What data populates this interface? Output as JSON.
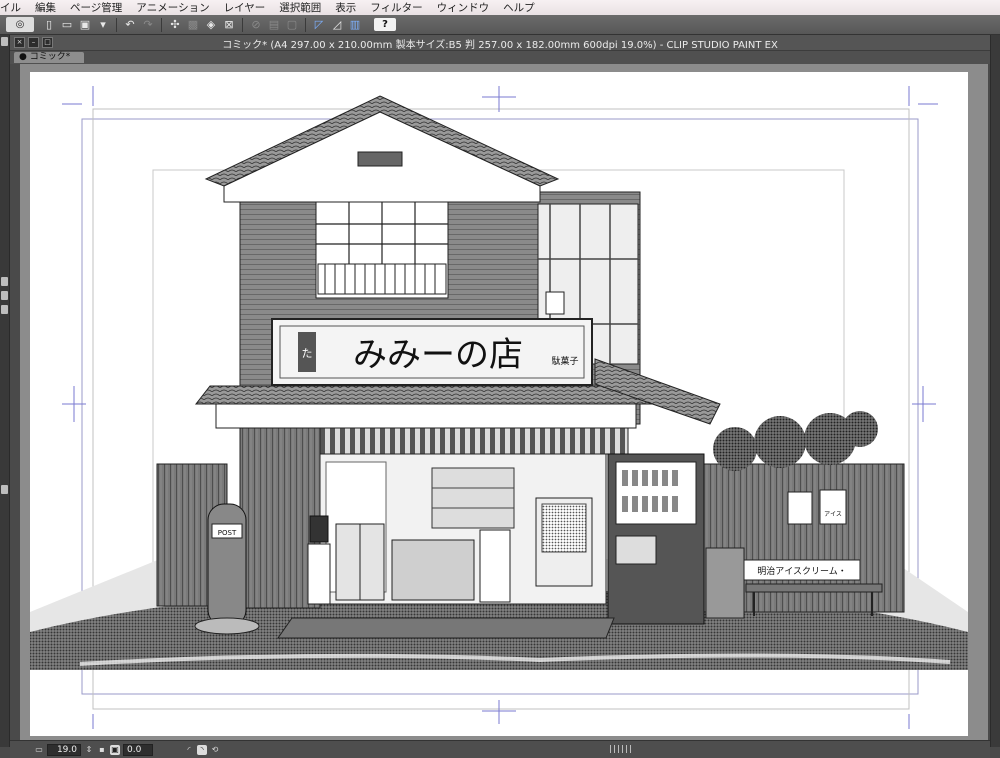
{
  "menu": [
    "イル",
    "編集",
    "ページ管理",
    "アニメーション",
    "レイヤー",
    "選択範囲",
    "表示",
    "フィルター",
    "ウィンドウ",
    "ヘルプ"
  ],
  "window": {
    "title": "コミック* (A4 297.00 x 210.00mm 製本サイズ:B5 判 257.00 x 182.00mm 600dpi 19.0%)  - CLIP STUDIO PAINT EX"
  },
  "tab": {
    "label": "コミック*"
  },
  "toolbar": {
    "help_label": "?"
  },
  "artwork": {
    "shop_sign": "みみーの店",
    "sign_tag": "た",
    "sign_sub": "駄菓子",
    "post_label": "POST",
    "bench_sign": "明治アイスクリーム・",
    "poster_text": "アイス"
  },
  "statusbar": {
    "zoom": "19.0",
    "rotation": "0.0"
  },
  "colors": {
    "menubar": "#efe8ea",
    "toolbar": "#5f5f5f",
    "canvas_bg": "#8c8c8c",
    "page": "#ffffff",
    "guide": "#6b6bcf"
  }
}
